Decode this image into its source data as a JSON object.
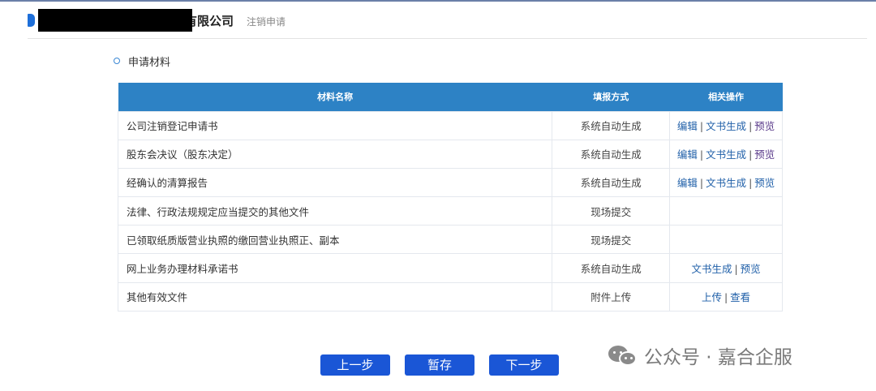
{
  "header": {
    "company_suffix": "有限公司",
    "subtitle": "注销申请"
  },
  "section": {
    "title": "申请材料"
  },
  "table": {
    "headers": [
      "材料名称",
      "填报方式",
      "相关操作"
    ],
    "rows": [
      {
        "name": "公司注销登记申请书",
        "mode": "系统自动生成",
        "ops": [
          "编辑",
          "文书生成",
          "预览"
        ]
      },
      {
        "name": "股东会决议（股东决定）",
        "mode": "系统自动生成",
        "ops": [
          "编辑",
          "文书生成",
          "预览"
        ]
      },
      {
        "name": "经确认的清算报告",
        "mode": "系统自动生成",
        "ops": [
          "编辑",
          "文书生成",
          "预览"
        ]
      },
      {
        "name": "法律、行政法规规定应当提交的其他文件",
        "mode": "现场提交",
        "ops": []
      },
      {
        "name": "已领取纸质版营业执照的缴回营业执照正、副本",
        "mode": "现场提交",
        "ops": []
      },
      {
        "name": "网上业务办理材料承诺书",
        "mode": "系统自动生成",
        "ops": [
          "文书生成",
          "预览"
        ]
      },
      {
        "name": "其他有效文件",
        "mode": "附件上传",
        "ops": [
          "上传",
          "查看"
        ]
      }
    ]
  },
  "buttons": {
    "prev": "上一步",
    "save": "暂存",
    "next": "下一步"
  },
  "watermark": {
    "text": "公众号 · 嘉合企服"
  },
  "colors": {
    "table_header": "#2d82c5",
    "button": "#1a56d6",
    "link": "#1f5fa8"
  }
}
